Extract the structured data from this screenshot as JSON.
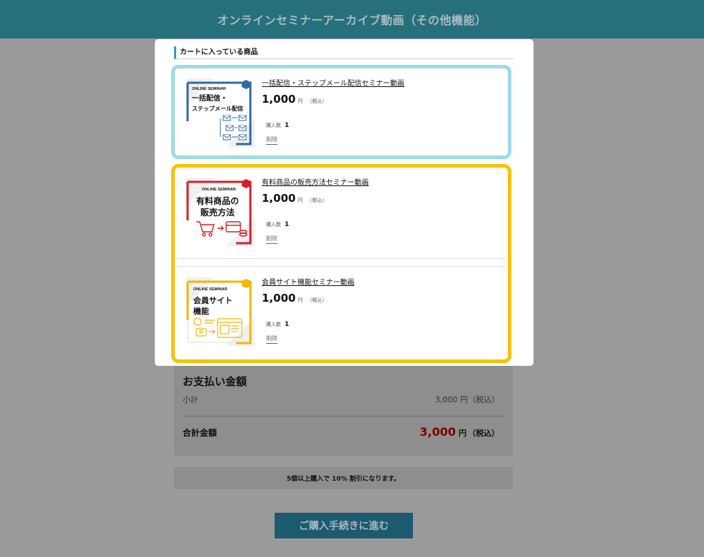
{
  "header": {
    "title": "オンラインセミナーアーカイブ動画（その他機能）"
  },
  "modal": {
    "heading": "カートに入っている商品",
    "items": [
      {
        "title": "一括配信・ステップメール配信セミナー動画",
        "price": "1,000",
        "unit": "円",
        "tax": "（税込）",
        "qty_label": "購入数",
        "qty": "1",
        "delete_label": "削除",
        "thumb": {
          "badge": "ONLINE SEMINAR",
          "line1": "一括配信・",
          "line2": "ステップメール配信",
          "accent": "#2f6aa3"
        }
      },
      {
        "title": "有料商品の販売方法セミナー動画",
        "price": "1,000",
        "unit": "円",
        "tax": "（税込）",
        "qty_label": "購入数",
        "qty": "1",
        "delete_label": "削除",
        "thumb": {
          "badge": "ONLINE SEMINAR",
          "line1": "有料商品の",
          "line2": "販売方法",
          "accent": "#d4202a"
        }
      },
      {
        "title": "会員サイト機能セミナー動画",
        "price": "1,000",
        "unit": "円",
        "tax": "（税込）",
        "qty_label": "購入数",
        "qty": "1",
        "delete_label": "削除",
        "thumb": {
          "badge": "ONLINE SEMINAR",
          "line1": "会員サイト",
          "line2": "機能",
          "accent": "#f2b705"
        }
      }
    ]
  },
  "summary": {
    "title": "お支払い金額",
    "subtotal_label": "小計",
    "subtotal_value": "3,000 円（税込）",
    "total_label": "合計金額",
    "total_value": "3,000",
    "total_unit": "円",
    "total_tax": "（税込）"
  },
  "discount_note": "5個以上購入で 10% 割引になります。",
  "checkout_label": "ご購入手続きに進む",
  "colors": {
    "header_bg": "#26707c",
    "blue_border": "#9edbea",
    "yellow_border": "#f8c200",
    "total_red": "#7a0000"
  }
}
